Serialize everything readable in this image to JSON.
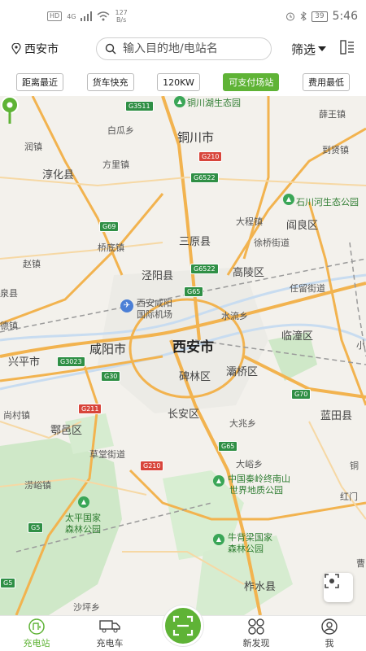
{
  "status_bar": {
    "net_badge": "HD",
    "net_gen": "4G",
    "speed_value": "127",
    "speed_unit": "B/s",
    "battery": "39",
    "time": "5:46"
  },
  "header": {
    "city": "西安市",
    "search_placeholder": "输入目的地/电站名",
    "filter_label": "筛选"
  },
  "chips": [
    {
      "label": "距离最近",
      "active": false
    },
    {
      "label": "货车快充",
      "active": false
    },
    {
      "label": "120KW",
      "active": false
    },
    {
      "label": "可支付场站",
      "active": true
    },
    {
      "label": "费用最低",
      "active": false
    }
  ],
  "map": {
    "labels": {
      "tongchuan": "铜川市",
      "xian": "西安市",
      "xianyang": "咸阳市",
      "baiguaxiang": "白瓜乡",
      "xuewangzhen": "薛王镇",
      "runzhen": "润镇",
      "chunhuaxian": "淳化县",
      "fanglizhen": "方里镇",
      "daoxianzhen": "到贤镇",
      "shichuanhe": "石川河生态公园",
      "dachengzhen": "大程镇",
      "yanliangqu": "阎良区",
      "qiaodizhen": "桥底镇",
      "sanyuanxian": "三原县",
      "xuqiaojiedao": "徐桥街道",
      "zhaozhen": "赵镇",
      "jingyangxian": "泾阳县",
      "gaolingqu": "高陵区",
      "renliujiedao": "任留街道",
      "liquan": "泉县",
      "dezhen": "德镇",
      "airport_line1": "西安咸阳",
      "airport_line2": "国际机场",
      "shuiliuxiang": "水流乡",
      "lintongqu": "临潼区",
      "xingpingshi": "兴平市",
      "beilinqu": "碑林区",
      "baqiaoqu": "灞桥区",
      "xiao": "小",
      "shangchuanzhen": "尚村镇",
      "changanqu": "长安区",
      "dazhaoxiang": "大兆乡",
      "lantianxian": "蓝田县",
      "huyiqu": "鄠邑区",
      "caotangjiedao": "草堂街道",
      "tongyu": "铜",
      "dayuxiang": "大峪乡",
      "qinlingpark_line1": "中国秦岭终南山",
      "qinlingpark_line2": "世界地质公园",
      "hongmen": "红门",
      "laoyuzhen": "涝峪镇",
      "taipingpark_line1": "太平国家",
      "taipingpark_line2": "森林公园",
      "niubeiliang_line1": "牛背梁国家",
      "niubeiliang_line2": "森林公园",
      "cao": "曹",
      "zhashuixian": "柞水县",
      "shapingxiang": "沙坪乡",
      "top_poi": "铜川湖生态园"
    },
    "shields": [
      "G3511",
      "G210",
      "G6522",
      "G69",
      "G6522",
      "G65",
      "G3023",
      "G30",
      "G211",
      "G70",
      "G65",
      "G210",
      "G5",
      "G5"
    ]
  },
  "bottom_nav": [
    {
      "label": "充电站",
      "icon": "charging-station-icon",
      "active": true
    },
    {
      "label": "充电车",
      "icon": "truck-icon",
      "active": false
    },
    {
      "label": "新发现",
      "icon": "discover-icon",
      "active": false
    },
    {
      "label": "我",
      "icon": "profile-icon",
      "active": false
    }
  ],
  "colors": {
    "accent": "#5fb336"
  }
}
